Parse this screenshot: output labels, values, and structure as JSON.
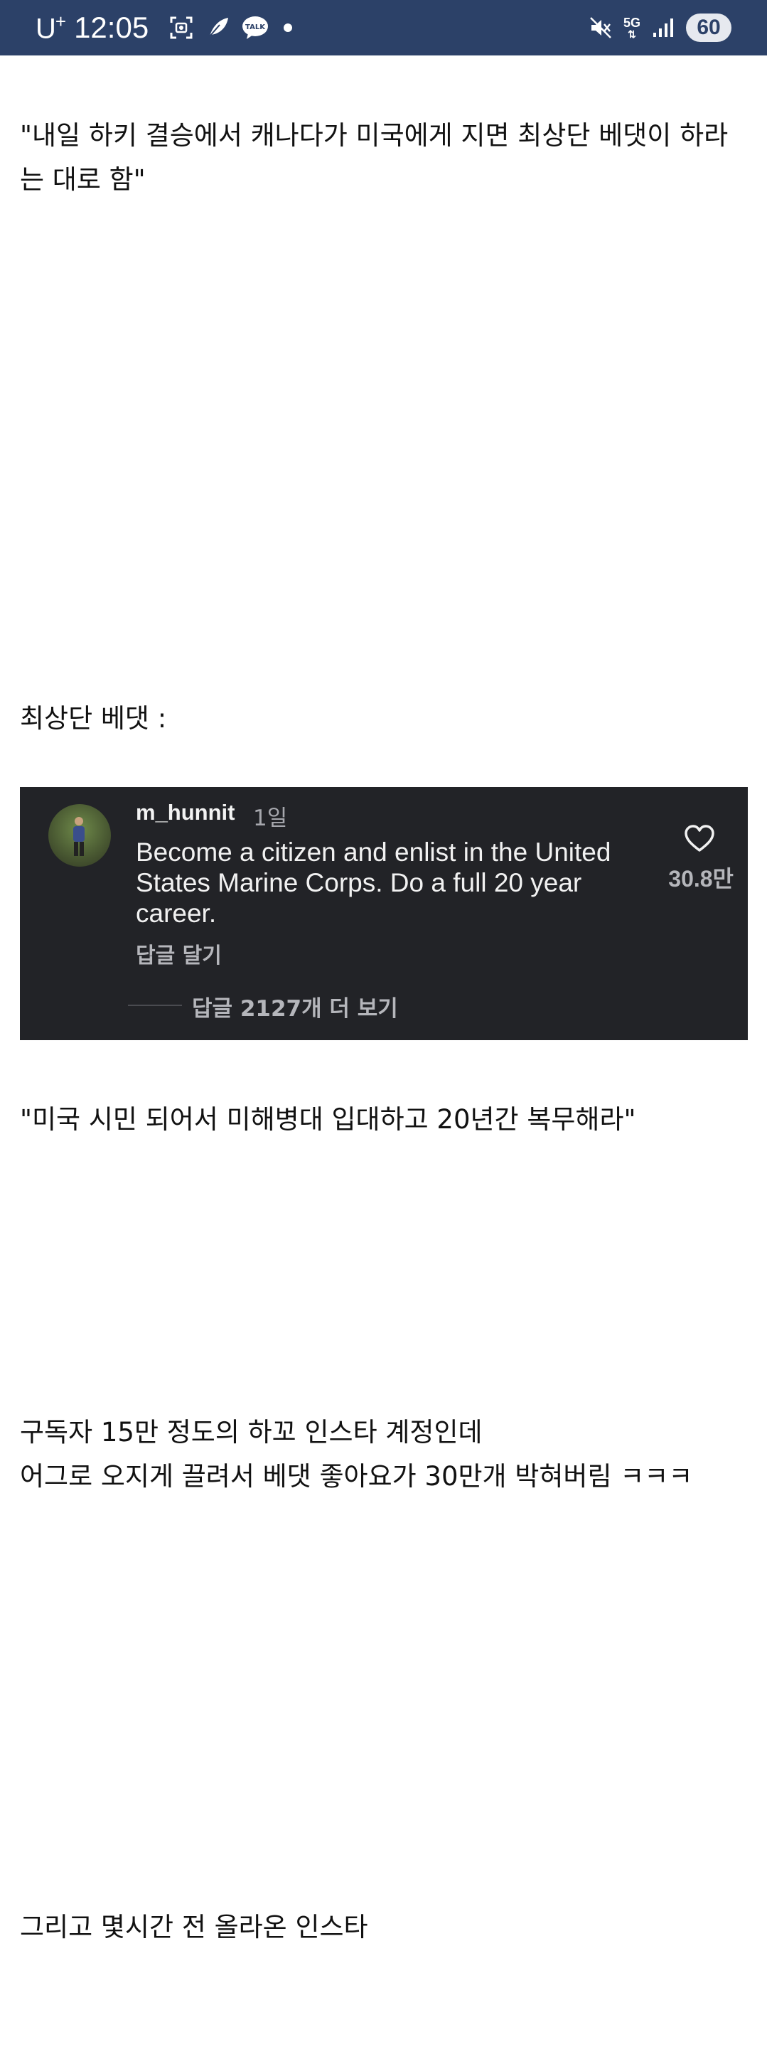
{
  "status_bar": {
    "carrier": "U",
    "carrier_sup": "+",
    "time": "12:05",
    "notif_icons": [
      "screenshot-icon",
      "feather-app-icon",
      "kakaotalk-icon"
    ],
    "kakao_label": "TALK",
    "network": "5G",
    "battery": "60",
    "colors": {
      "background": "#2c4168"
    }
  },
  "post": {
    "paragraph_1": "\"내일 하키 결승에서 캐나다가 미국에게 지면 최상단 베댓이 하라는 대로 함\"",
    "paragraph_2": "최상단 베댓 :",
    "paragraph_3": "\"미국 시민 되어서 미해병대 입대하고 20년간 복무해라\"",
    "paragraph_4_line_1": "구독자 15만 정도의 하꼬 인스타 계정인데",
    "paragraph_4_line_2": "어그로 오지게 끌려서 베댓 좋아요가 30만개 박혀버림 ㅋㅋㅋ",
    "paragraph_5": "그리고 몇시간 전 올라온 인스타"
  },
  "comment": {
    "username": "m_hunnit",
    "time_ago": "1일",
    "text": "Become a citizen and enlist in the United States Marine Corps. Do a full 20 year career.",
    "reply_label": "답글 달기",
    "like_count": "30.8만",
    "view_replies": "답글 2127개 더 보기",
    "colors": {
      "background": "#222327"
    }
  }
}
